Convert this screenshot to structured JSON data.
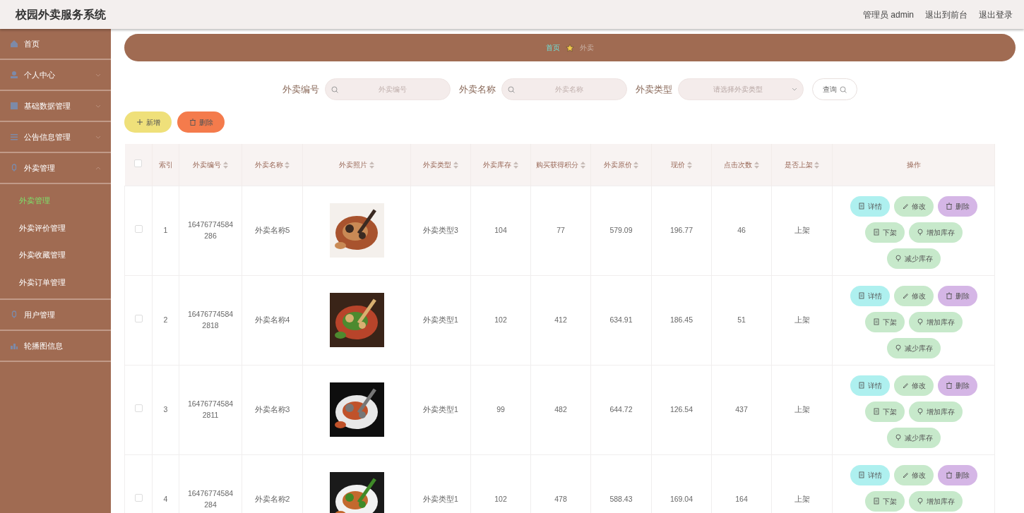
{
  "header": {
    "title": "校园外卖服务系统",
    "links": [
      "管理员 admin",
      "退出到前台",
      "退出登录"
    ]
  },
  "sidebar": {
    "items": [
      {
        "label": "首页",
        "expandable": false
      },
      {
        "label": "个人中心",
        "expandable": true,
        "expanded": false
      },
      {
        "label": "基础数据管理",
        "expandable": true,
        "expanded": false
      },
      {
        "label": "公告信息管理",
        "expandable": true,
        "expanded": false
      },
      {
        "label": "外卖管理",
        "expandable": true,
        "expanded": true,
        "children": [
          {
            "label": "外卖管理",
            "selected": true
          },
          {
            "label": "外卖评价管理",
            "selected": false
          },
          {
            "label": "外卖收藏管理",
            "selected": false
          },
          {
            "label": "外卖订单管理",
            "selected": false
          }
        ]
      },
      {
        "label": "用户管理",
        "expandable": false
      },
      {
        "label": "轮播图信息",
        "expandable": false
      }
    ]
  },
  "breadcrumb": [
    {
      "label": "首页",
      "selected": false
    },
    {
      "label": "外卖",
      "selected": true
    }
  ],
  "search": {
    "fields": [
      {
        "kind": "text",
        "label": "外卖编号",
        "placeholder": "外卖编号"
      },
      {
        "kind": "text",
        "label": "外卖名称",
        "placeholder": "外卖名称"
      },
      {
        "kind": "select",
        "label": "外卖类型",
        "placeholder": "请选择外卖类型"
      }
    ],
    "button": "查询"
  },
  "toolbar": [
    {
      "kind": "add",
      "label": "新增"
    },
    {
      "kind": "delete",
      "label": "删除"
    }
  ],
  "table": {
    "select_all_checked": false,
    "columns": [
      {
        "label": "索引",
        "sortable": false
      },
      {
        "label": "外卖编号",
        "sortable": true
      },
      {
        "label": "外卖名称",
        "sortable": true
      },
      {
        "label": "外卖照片",
        "sortable": true
      },
      {
        "label": "外卖类型",
        "sortable": true
      },
      {
        "label": "外卖库存",
        "sortable": true
      },
      {
        "label": "购买获得积分",
        "sortable": true
      },
      {
        "label": "外卖原价",
        "sortable": true
      },
      {
        "label": "现价",
        "sortable": true
      },
      {
        "label": "点击次数",
        "sortable": true
      },
      {
        "label": "是否上架",
        "sortable": true
      },
      {
        "label": "操作",
        "sortable": false
      }
    ],
    "rows": [
      {
        "checked": false,
        "index": "1",
        "code": "16476774584286",
        "name": "外卖名称5",
        "photo": {
          "kind": "picture"
        },
        "type": "外卖类型3",
        "stock": "104",
        "points": "77",
        "original_price": "579.09",
        "price": "196.77",
        "clicks": "46",
        "on_shelf": "上架",
        "actions": [
          {
            "kind": "detail",
            "label": "详情"
          },
          {
            "kind": "edit",
            "label": "修改"
          },
          {
            "kind": "delete",
            "label": "删除"
          },
          {
            "kind": "unlist",
            "label": "下架"
          },
          {
            "kind": "stock",
            "label": "增加库存"
          },
          {
            "kind": "stock",
            "label": "减少库存"
          }
        ]
      },
      {
        "checked": false,
        "index": "2",
        "code": "164767745842818",
        "name": "外卖名称4",
        "photo": {
          "kind": "picture"
        },
        "type": "外卖类型1",
        "stock": "102",
        "points": "412",
        "original_price": "634.91",
        "price": "186.45",
        "clicks": "51",
        "on_shelf": "上架",
        "actions": [
          {
            "kind": "detail",
            "label": "详情"
          },
          {
            "kind": "edit",
            "label": "修改"
          },
          {
            "kind": "delete",
            "label": "删除"
          },
          {
            "kind": "unlist",
            "label": "下架"
          },
          {
            "kind": "stock",
            "label": "增加库存"
          },
          {
            "kind": "stock",
            "label": "减少库存"
          }
        ]
      },
      {
        "checked": false,
        "index": "3",
        "code": "164767745842811",
        "name": "外卖名称3",
        "photo": {
          "kind": "picture"
        },
        "type": "外卖类型1",
        "stock": "99",
        "points": "482",
        "original_price": "644.72",
        "price": "126.54",
        "clicks": "437",
        "on_shelf": "上架",
        "actions": [
          {
            "kind": "detail",
            "label": "详情"
          },
          {
            "kind": "edit",
            "label": "修改"
          },
          {
            "kind": "delete",
            "label": "删除"
          },
          {
            "kind": "unlist",
            "label": "下架"
          },
          {
            "kind": "stock",
            "label": "增加库存"
          },
          {
            "kind": "stock",
            "label": "减少库存"
          }
        ]
      },
      {
        "checked": false,
        "index": "4",
        "code": "16476774584284",
        "name": "外卖名称2",
        "photo": {
          "kind": "picture"
        },
        "type": "外卖类型1",
        "stock": "102",
        "points": "478",
        "original_price": "588.43",
        "price": "169.04",
        "clicks": "164",
        "on_shelf": "上架",
        "actions": [
          {
            "kind": "detail",
            "label": "详情"
          },
          {
            "kind": "edit",
            "label": "修改"
          },
          {
            "kind": "delete",
            "label": "删除"
          },
          {
            "kind": "unlist",
            "label": "下架"
          },
          {
            "kind": "stock",
            "label": "增加库存"
          }
        ]
      }
    ]
  }
}
